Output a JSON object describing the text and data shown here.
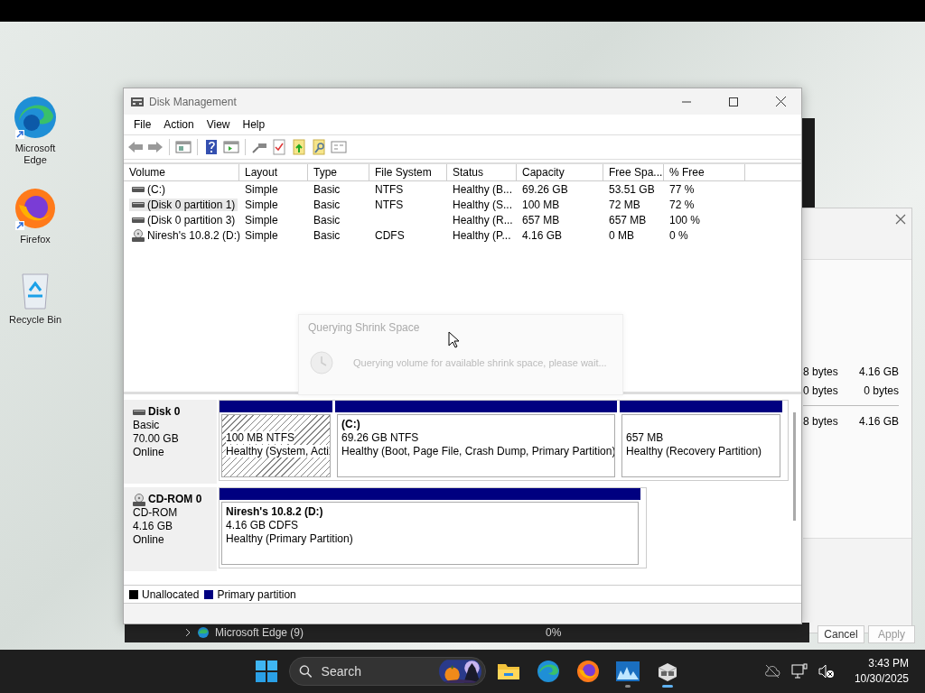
{
  "desktop_icons": [
    {
      "kind": "edge",
      "label": "Microsoft Edge"
    },
    {
      "kind": "firefox",
      "label": "Firefox"
    },
    {
      "kind": "recycle",
      "label": "Recycle Bin"
    }
  ],
  "background_dialog": {
    "rows": [
      [
        "8 bytes",
        "4.16 GB"
      ],
      [
        "0 bytes",
        "0 bytes"
      ],
      [
        "8 bytes",
        "4.16 GB"
      ]
    ],
    "buttons": [
      "Cancel",
      "Apply"
    ]
  },
  "task_manager_row": {
    "name": "Microsoft Edge (9)",
    "cpu": "0%"
  },
  "window": {
    "title": "Disk Management"
  },
  "menu": [
    "File",
    "Action",
    "View",
    "Help"
  ],
  "volume_table": {
    "columns": [
      "Volume",
      "Layout",
      "Type",
      "File System",
      "Status",
      "Capacity",
      "Free Spa...",
      "% Free"
    ],
    "rows": [
      {
        "kind": "disk",
        "selected": false,
        "cells": [
          "(C:)",
          "Simple",
          "Basic",
          "NTFS",
          "Healthy (B...",
          "69.26 GB",
          "53.51 GB",
          "77 %"
        ]
      },
      {
        "kind": "disk",
        "selected": true,
        "cells": [
          "(Disk 0 partition 1)",
          "Simple",
          "Basic",
          "NTFS",
          "Healthy (S...",
          "100 MB",
          "72 MB",
          "72 %"
        ]
      },
      {
        "kind": "disk",
        "selected": false,
        "cells": [
          "(Disk 0 partition 3)",
          "Simple",
          "Basic",
          "",
          "Healthy (R...",
          "657 MB",
          "657 MB",
          "100 %"
        ]
      },
      {
        "kind": "cdrom",
        "selected": false,
        "cells": [
          "Niresh's 10.8.2 (D:)",
          "Simple",
          "Basic",
          "CDFS",
          "Healthy (P...",
          "4.16 GB",
          "0 MB",
          "0 %"
        ]
      }
    ]
  },
  "dialog": {
    "title": "Querying Shrink Space",
    "message": "Querying volume for available shrink space, please wait..."
  },
  "disks": [
    {
      "kind": "disk",
      "name": "Disk 0",
      "type": "Basic",
      "size": "70.00 GB",
      "status": "Online",
      "partitions": [
        {
          "size": "100 MB NTFS",
          "status": "Healthy (System, Acti",
          "hatched": true
        },
        {
          "name": "(C:)",
          "size": "69.26 GB NTFS",
          "status": "Healthy (Boot, Page File, Crash Dump, Primary Partition)",
          "hatched": false
        },
        {
          "size": "657 MB",
          "status": "Healthy (Recovery Partition)",
          "hatched": false
        }
      ]
    },
    {
      "kind": "cdrom",
      "name": "CD-ROM 0",
      "type": "CD-ROM",
      "size": "4.16 GB",
      "status": "Online",
      "partitions": [
        {
          "name": "Niresh's 10.8.2  (D:)",
          "size": "4.16 GB CDFS",
          "status": "Healthy (Primary Partition)",
          "hatched": false
        }
      ]
    }
  ],
  "legend": [
    {
      "label": "Unallocated",
      "color": "#000000"
    },
    {
      "label": "Primary partition",
      "color": "#000080"
    }
  ],
  "taskbar": {
    "search_placeholder": "Search",
    "time": "3:43 PM",
    "date": "10/30/2025"
  }
}
